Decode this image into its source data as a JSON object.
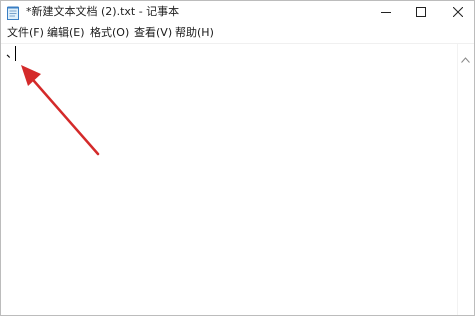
{
  "window": {
    "title": "*新建文本文档 (2).txt - 记事本"
  },
  "icons": {
    "app": "notepad-icon",
    "minimize": "minimize-icon",
    "maximize": "maximize-icon",
    "close": "close-icon",
    "scroll_up": "chevron-up-icon",
    "annotation": "red-arrow-annotation"
  },
  "menu": {
    "file": "文件(F)",
    "edit": "编辑(E)",
    "format": "格式(O)",
    "view": "查看(V)",
    "help": "帮助(H)"
  },
  "editor": {
    "content": "、"
  },
  "colors": {
    "arrow": "#d42a2a",
    "text": "#1a1a1a"
  }
}
